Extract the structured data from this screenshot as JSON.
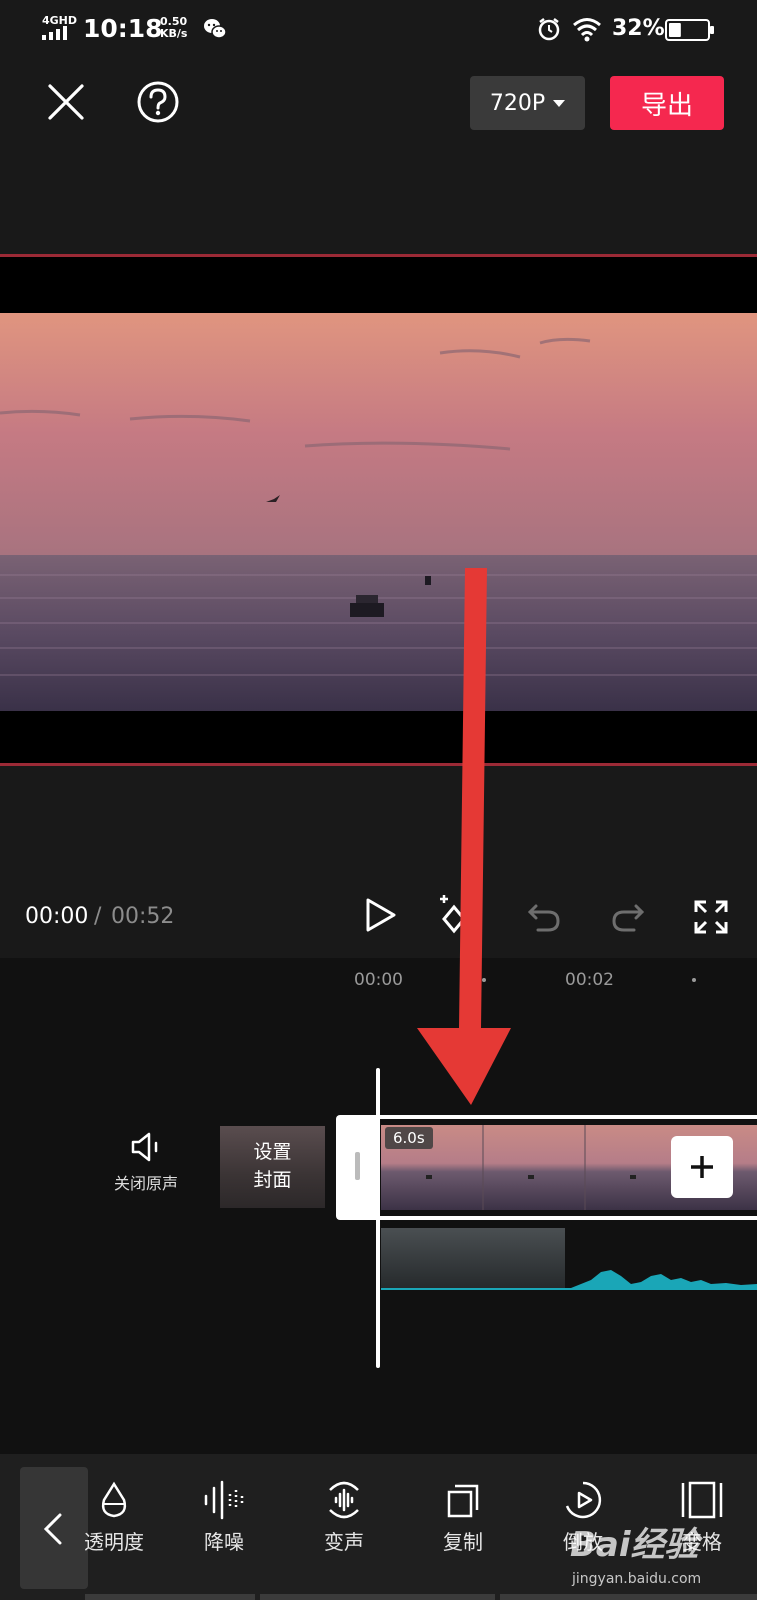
{
  "status_bar": {
    "network": "4GHD",
    "time": "10:18",
    "speed_value": "0.50",
    "speed_unit": "KB/s",
    "battery_percent": "32%",
    "battery_level": 0.32
  },
  "toolbar": {
    "resolution": "720P",
    "export_label": "导出"
  },
  "playback": {
    "current_time": "00:00",
    "separator": "/",
    "total_time": "00:52"
  },
  "timeline": {
    "ticks": [
      "00:00",
      "00:02"
    ],
    "mute_label": "关闭原声",
    "cover_label_line1": "设置",
    "cover_label_line2": "封面",
    "clip_duration": "6.0s"
  },
  "bottom_tools": [
    {
      "label": "透明度",
      "icon": "drop-icon"
    },
    {
      "label": "降噪",
      "icon": "waveform-bars-icon"
    },
    {
      "label": "变声",
      "icon": "voice-change-icon"
    },
    {
      "label": "复制",
      "icon": "copy-icon"
    },
    {
      "label": "倒放",
      "icon": "reverse-play-icon"
    },
    {
      "label": "变格",
      "icon": "frame-icon"
    }
  ],
  "watermark": {
    "logo": "Bai经验",
    "url": "jingyan.baidu.com"
  },
  "colors": {
    "accent": "#f5284f",
    "arrow": "#e53935",
    "waveform": "#1aa6b7"
  }
}
